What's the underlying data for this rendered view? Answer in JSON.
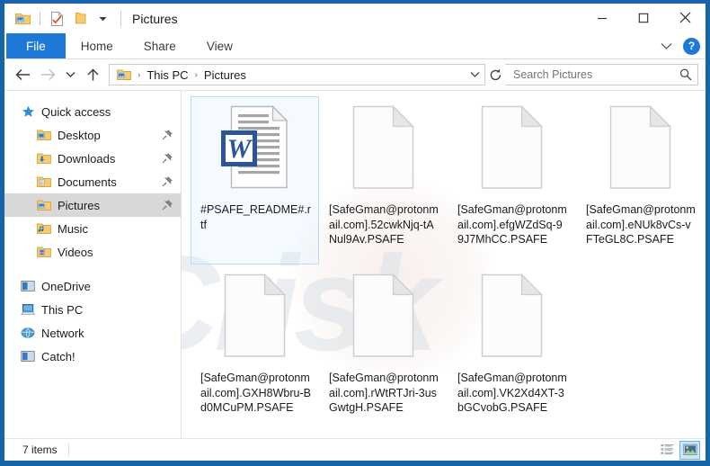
{
  "window": {
    "title": "Pictures",
    "minimize_label": "Minimize",
    "maximize_label": "Maximize",
    "close_label": "Close",
    "accent_color": "#1565a8",
    "tab_active_color": "#1e78d7"
  },
  "quick_access_toolbar": {
    "items": [
      {
        "name": "pictures-folder-icon",
        "label": "Pictures"
      },
      {
        "name": "properties-icon",
        "label": "Properties"
      },
      {
        "name": "new-folder-icon",
        "label": "New folder"
      },
      {
        "name": "customize-caret-icon",
        "label": "Customize Quick Access Toolbar"
      }
    ]
  },
  "ribbon": {
    "tabs": [
      {
        "label": "File",
        "active": true
      },
      {
        "label": "Home",
        "active": false
      },
      {
        "label": "Share",
        "active": false
      },
      {
        "label": "View",
        "active": false
      }
    ],
    "expand_label": "Expand the Ribbon",
    "help_label": "?"
  },
  "navigation": {
    "back_label": "Back",
    "forward_label": "Forward",
    "recent_label": "Recent locations",
    "up_label": "Up",
    "refresh_label": "Refresh",
    "history_label": "Previous locations"
  },
  "address_bar": {
    "breadcrumbs": [
      "This PC",
      "Pictures"
    ],
    "separator": "›"
  },
  "search": {
    "placeholder": "Search Pictures",
    "value": ""
  },
  "sidebar": {
    "items": [
      {
        "label": "Quick access",
        "icon": "star-icon",
        "level": 0,
        "pinned": false,
        "selected": false
      },
      {
        "label": "Desktop",
        "icon": "desktop-folder-icon",
        "level": 1,
        "pinned": true,
        "selected": false
      },
      {
        "label": "Downloads",
        "icon": "downloads-folder-icon",
        "level": 1,
        "pinned": true,
        "selected": false
      },
      {
        "label": "Documents",
        "icon": "documents-folder-icon",
        "level": 1,
        "pinned": true,
        "selected": false
      },
      {
        "label": "Pictures",
        "icon": "pictures-folder-icon",
        "level": 1,
        "pinned": true,
        "selected": true
      },
      {
        "label": "Music",
        "icon": "music-folder-icon",
        "level": 1,
        "pinned": false,
        "selected": false
      },
      {
        "label": "Videos",
        "icon": "videos-folder-icon",
        "level": 1,
        "pinned": false,
        "selected": false
      },
      {
        "label": "OneDrive",
        "icon": "onedrive-icon",
        "level": 0,
        "pinned": false,
        "selected": false
      },
      {
        "label": "This PC",
        "icon": "this-pc-icon",
        "level": 0,
        "pinned": false,
        "selected": false
      },
      {
        "label": "Network",
        "icon": "network-icon",
        "level": 0,
        "pinned": false,
        "selected": false
      },
      {
        "label": "Catch!",
        "icon": "catch-drive-icon",
        "level": 0,
        "pinned": false,
        "selected": false
      }
    ]
  },
  "files": [
    {
      "name": "#PSAFE_README#.rtf",
      "icon": "word-document-icon",
      "selected": true
    },
    {
      "name": "[SafeGman@protonmail.com].52cwkNjq-tANul9Av.PSAFE",
      "icon": "blank-file-icon",
      "selected": false
    },
    {
      "name": "[SafeGman@protonmail.com].efgWZdSq-99J7MhCC.PSAFE",
      "icon": "blank-file-icon",
      "selected": false
    },
    {
      "name": "[SafeGman@protonmail.com].eNUk8vCs-vFTeGL8C.PSAFE",
      "icon": "blank-file-icon",
      "selected": false
    },
    {
      "name": "[SafeGman@protonmail.com].GXH8Wbru-Bd0MCuPM.PSAFE",
      "icon": "blank-file-icon",
      "selected": false
    },
    {
      "name": "[SafeGman@protonmail.com].rWtRTJri-3usGwtgH.PSAFE",
      "icon": "blank-file-icon",
      "selected": false
    },
    {
      "name": "[SafeGman@protonmail.com].VK2Xd4XT-3bGCvobG.PSAFE",
      "icon": "blank-file-icon",
      "selected": false
    }
  ],
  "status_bar": {
    "item_count": "7 items",
    "details_view_label": "Details view",
    "large_icons_view_label": "Large icons view",
    "active_view": "large-icons"
  }
}
